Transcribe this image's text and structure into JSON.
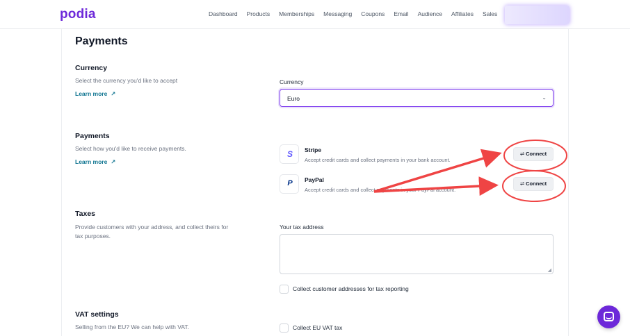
{
  "app": {
    "logo": "podia"
  },
  "nav": {
    "items": [
      "Dashboard",
      "Products",
      "Memberships",
      "Messaging",
      "Coupons",
      "Email",
      "Audience",
      "Affiliates",
      "Sales"
    ]
  },
  "page": {
    "title": "Payments"
  },
  "currency": {
    "title": "Currency",
    "description": "Select the currency you'd like to accept",
    "learn_more": "Learn more",
    "field_label": "Currency",
    "selected": "Euro"
  },
  "payments": {
    "title": "Payments",
    "description": "Select how you'd like to receive payments.",
    "learn_more": "Learn more",
    "providers": [
      {
        "name": "Stripe",
        "description": "Accept credit cards and collect payments in your bank account.",
        "icon": "S",
        "button": "Connect"
      },
      {
        "name": "PayPal",
        "description": "Accept credit cards and collect payments in your PayPal account.",
        "icon": "P",
        "button": "Connect"
      }
    ]
  },
  "taxes": {
    "title": "Taxes",
    "description": "Provide customers with your address, and collect theirs for tax purposes.",
    "field_label": "Your tax address",
    "textarea_value": "",
    "checkbox_label": "Collect customer addresses for tax reporting"
  },
  "vat": {
    "title": "VAT settings",
    "description": "Selling from the EU? We can help with VAT.",
    "checkbox_label": "Collect EU VAT tax"
  },
  "colors": {
    "brand": "#6d28d9",
    "link": "#0e7490",
    "annotation": "#ef4444"
  }
}
